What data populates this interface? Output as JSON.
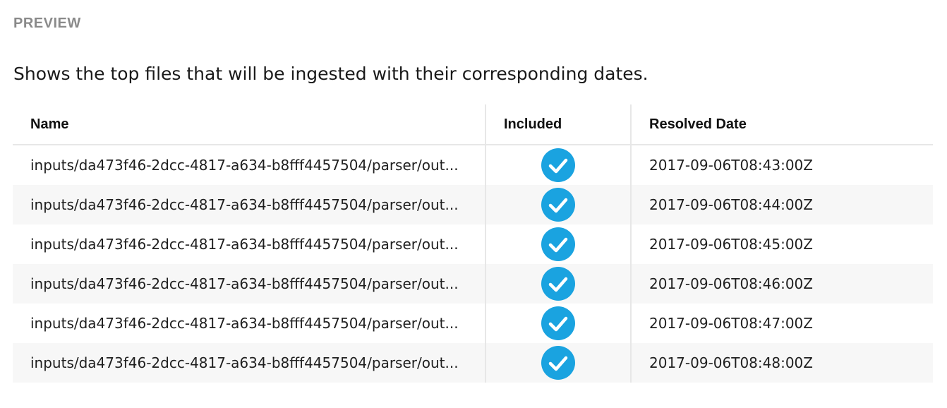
{
  "section": {
    "title": "PREVIEW",
    "description": "Shows the top files that will be ingested with their corresponding dates."
  },
  "colors": {
    "accent": "#1aa3e0",
    "header_text": "#8a8a8a",
    "row_alt": "#f7f7f7"
  },
  "table": {
    "columns": {
      "name": "Name",
      "included": "Included",
      "resolved_date": "Resolved Date"
    },
    "rows": [
      {
        "name": "inputs/da473f46-2dcc-4817-a634-b8fff4457504/parser/out...",
        "included_icon": "check-circle-icon",
        "resolved_date": "2017-09-06T08:43:00Z"
      },
      {
        "name": "inputs/da473f46-2dcc-4817-a634-b8fff4457504/parser/out...",
        "included_icon": "check-circle-icon",
        "resolved_date": "2017-09-06T08:44:00Z"
      },
      {
        "name": "inputs/da473f46-2dcc-4817-a634-b8fff4457504/parser/out...",
        "included_icon": "check-circle-icon",
        "resolved_date": "2017-09-06T08:45:00Z"
      },
      {
        "name": "inputs/da473f46-2dcc-4817-a634-b8fff4457504/parser/out...",
        "included_icon": "check-circle-icon",
        "resolved_date": "2017-09-06T08:46:00Z"
      },
      {
        "name": "inputs/da473f46-2dcc-4817-a634-b8fff4457504/parser/out...",
        "included_icon": "check-circle-icon",
        "resolved_date": "2017-09-06T08:47:00Z"
      },
      {
        "name": "inputs/da473f46-2dcc-4817-a634-b8fff4457504/parser/out...",
        "included_icon": "check-circle-icon",
        "resolved_date": "2017-09-06T08:48:00Z"
      }
    ]
  }
}
